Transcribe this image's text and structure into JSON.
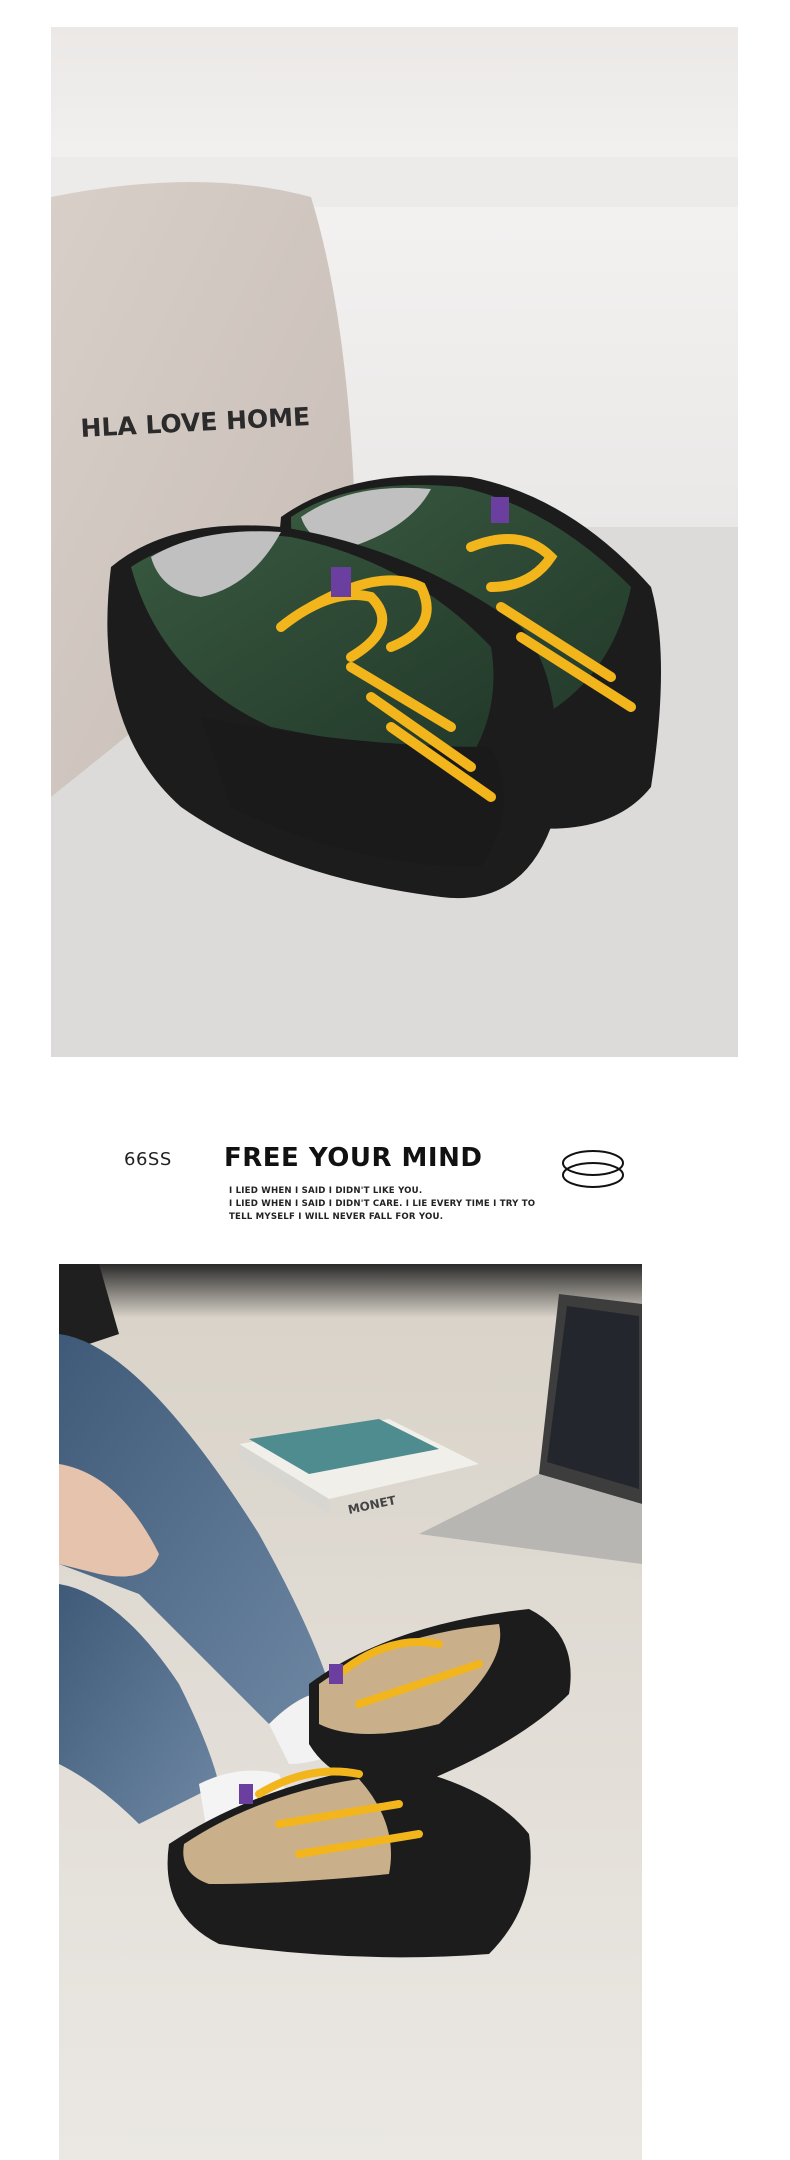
{
  "photo_top": {
    "pillow_print": "HLA LOVE HOME",
    "product_color": "green",
    "accent_colors": {
      "lace": "#f2b51c",
      "pull_tab": "#6b3fa0",
      "sole": "#1c1c1c",
      "upper": "#2f4a36"
    }
  },
  "tagline": {
    "code": "66SS",
    "headline": "FREE YOUR MIND",
    "lines": [
      "I LIED WHEN I SAID I DIDN'T LIKE YOU.",
      "I LIED WHEN I SAID I DIDN'T CARE. I LIE EVERY TIME I TRY TO",
      "TELL MYSELF I WILL NEVER FALL FOR YOU."
    ],
    "icon": "double-ring-icon"
  },
  "photo_bottom": {
    "book_title": "MONET",
    "product_color": "khaki",
    "accent_colors": {
      "lace": "#f2b51c",
      "pull_tab": "#6b3fa0",
      "sole": "#1c1c1c",
      "upper": "#c9b08a"
    }
  }
}
